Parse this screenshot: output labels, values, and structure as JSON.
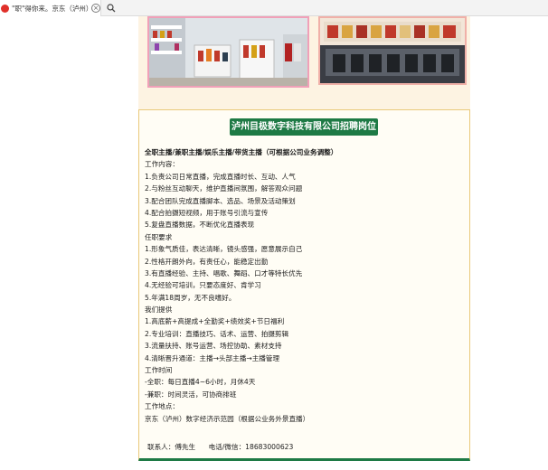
{
  "browser": {
    "tab_title": "\"职\"得你来。京东（泸州）...",
    "close_glyph": "×"
  },
  "card": {
    "title": "泸州目极数字科技有限公司招聘岗位",
    "lines": [
      {
        "text": "全职主播/兼职主播/娱乐主播/带货主播（可根据公司业务调整）",
        "bold": true
      },
      {
        "text": "工作内容：",
        "bold": false
      },
      {
        "text": "1.负责公司日常直播，完成直播时长、互动、人气",
        "bold": false
      },
      {
        "text": "2.与粉丝互动聊天，维护直播间氛围，解答观众问题",
        "bold": false
      },
      {
        "text": "3.配合团队完成直播脚本、选品、场景及活动策划",
        "bold": false
      },
      {
        "text": "4.配合拍摄短视频，用于账号引流与宣传",
        "bold": false
      },
      {
        "text": "5.复盘直播数据，不断优化直播表现",
        "bold": false
      },
      {
        "text": "任职要求",
        "bold": false
      },
      {
        "text": "1.形象气质佳，表达清晰，镜头感强，愿意展示自己",
        "bold": false
      },
      {
        "text": "2.性格开朗外向，有责任心，能稳定出勤",
        "bold": false
      },
      {
        "text": "3.有直播经验、主持、唱歌、舞蹈、口才等特长优先",
        "bold": false
      },
      {
        "text": "4.无经验可培训，只要态度好、肯学习",
        "bold": false
      },
      {
        "text": "5.年满18周岁，无不良嗜好。",
        "bold": false
      },
      {
        "text": "我们提供",
        "bold": false
      },
      {
        "text": "1.高底薪+高提成+全勤奖+绩效奖+节日福利",
        "bold": false
      },
      {
        "text": "2.专业培训：直播技巧、话术、运营、拍摄剪辑",
        "bold": false
      },
      {
        "text": "3.流量扶持、账号运营、场控协助、素材支持",
        "bold": false
      },
      {
        "text": "4.清晰晋升通道：主播→头部主播→主播管理",
        "bold": false
      },
      {
        "text": "工作时间",
        "bold": false
      },
      {
        "text": "-全职：每日直播4~6小时，月休4天",
        "bold": false
      },
      {
        "text": "-兼职：时间灵活，可协商排班",
        "bold": false
      },
      {
        "text": "工作地点：",
        "bold": false
      },
      {
        "text": "京东（泸州）数字经济示范园（根据公业务外景直播）",
        "bold": false
      }
    ],
    "contact_label": "联系人：傅先生",
    "phone_label": "电话/微信：18683000623"
  },
  "icons": {
    "favicon": "brand-favicon",
    "close": "close-icon",
    "search": "search-icon"
  },
  "colors": {
    "title_bg": "#1e7a45",
    "card_border": "#e9c97a",
    "cream": "#fdf3e2"
  }
}
